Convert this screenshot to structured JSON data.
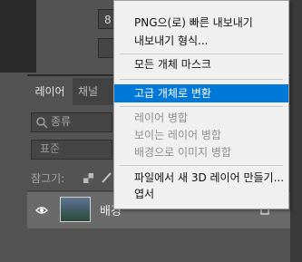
{
  "top_panel": {
    "font_size_value": "8"
  },
  "layers_panel": {
    "tabs": [
      {
        "label": "레이어",
        "active": true
      },
      {
        "label": "채널",
        "active": false
      }
    ],
    "filter_label": "종류",
    "blend_mode": "표준",
    "lock_label": "잠그기:",
    "layer": {
      "name": "배경",
      "visible": true,
      "locked": true
    }
  },
  "context_menu": {
    "items": [
      {
        "label": "PNG으(로) 빠른 내보내기",
        "enabled": true
      },
      {
        "label": "내보내기 형식...",
        "enabled": true
      },
      {
        "label": "모든 개체 마스크",
        "enabled": true
      },
      {
        "label": "고급 개체로 변환",
        "enabled": true,
        "highlighted": true
      },
      {
        "label": "레이어 병합",
        "enabled": false
      },
      {
        "label": "보이는 레이어 병합",
        "enabled": false
      },
      {
        "label": "배경으로 이미지 병합",
        "enabled": false
      },
      {
        "label": "파일에서 새 3D 레이어 만들기...",
        "enabled": true
      },
      {
        "label": "엽서",
        "enabled": true
      }
    ],
    "highlight_color": "#0078d7"
  }
}
